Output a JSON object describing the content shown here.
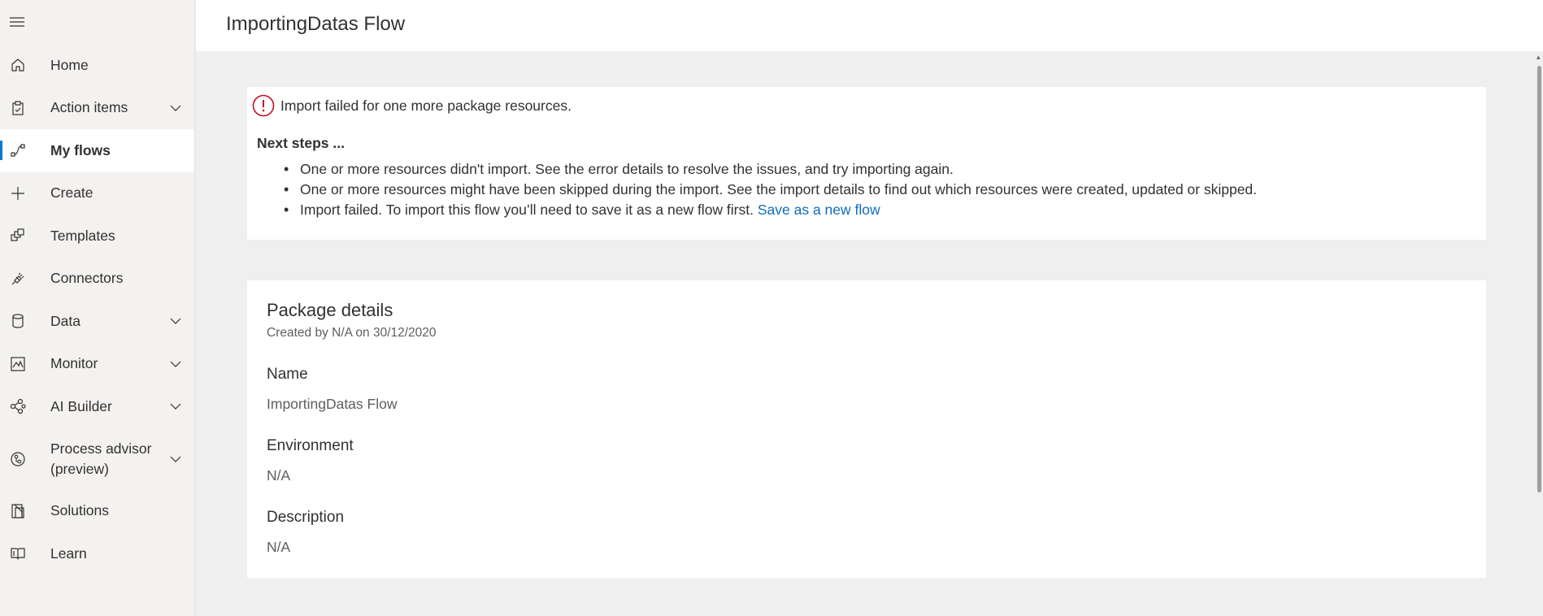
{
  "header": {
    "title": "ImportingDatas Flow"
  },
  "sidebar": {
    "items": [
      {
        "label": "Home",
        "icon": "home-icon"
      },
      {
        "label": "Action items",
        "icon": "clipboard-icon",
        "expandable": true
      },
      {
        "label": "My flows",
        "icon": "flow-icon",
        "active": true
      },
      {
        "label": "Create",
        "icon": "plus-icon"
      },
      {
        "label": "Templates",
        "icon": "templates-icon"
      },
      {
        "label": "Connectors",
        "icon": "connector-plug-icon"
      },
      {
        "label": "Data",
        "icon": "database-icon",
        "expandable": true
      },
      {
        "label": "Monitor",
        "icon": "monitor-chart-icon",
        "expandable": true
      },
      {
        "label": "AI Builder",
        "icon": "ai-builder-icon",
        "expandable": true
      },
      {
        "label": "Process advisor",
        "label2": "(preview)",
        "icon": "process-advisor-icon",
        "expandable": true
      },
      {
        "label": "Solutions",
        "icon": "solutions-icon"
      },
      {
        "label": "Learn",
        "icon": "book-icon"
      }
    ]
  },
  "error_card": {
    "message": "Import failed for one more package resources.",
    "next_steps_title": "Next steps ...",
    "steps": [
      "One or more resources didn't import. See the error details to resolve the issues, and try importing again.",
      "One or more resources might have been skipped during the import. See the import details to find out which resources were created, updated or skipped.",
      "Import failed. To import this flow you’ll need to save it as a new flow first."
    ],
    "link_text": "Save as a new flow"
  },
  "package": {
    "title": "Package details",
    "created": "Created by N/A on 30/12/2020",
    "fields": [
      {
        "label": "Name",
        "value": "ImportingDatas Flow"
      },
      {
        "label": "Environment",
        "value": "N/A"
      },
      {
        "label": "Description",
        "value": "N/A"
      }
    ]
  },
  "colors": {
    "accent": "#0078d4",
    "link": "#0f6cbd",
    "error": "#c50f1f"
  }
}
